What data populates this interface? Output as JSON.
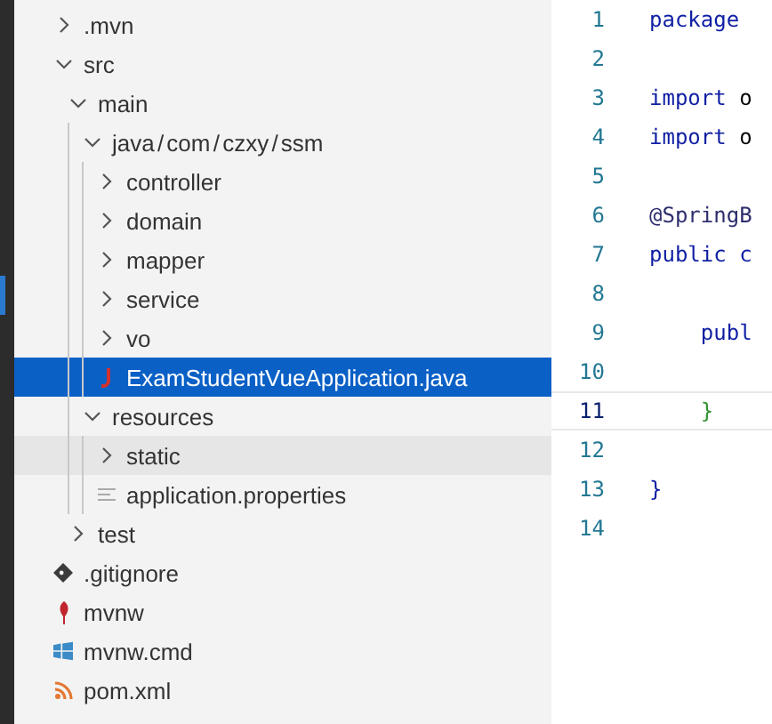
{
  "explorer": {
    "items": [
      {
        "label": ".mvn",
        "kind": "folder",
        "expanded": false,
        "selected": false,
        "hovered": false
      },
      {
        "label": "src",
        "kind": "folder",
        "expanded": true,
        "selected": false,
        "hovered": false,
        "children": [
          {
            "label": "main",
            "kind": "folder",
            "expanded": true,
            "selected": false,
            "hovered": false,
            "children": [
              {
                "label": "java / com / czxy / ssm",
                "kind": "folder",
                "expanded": true,
                "selected": false,
                "hovered": false,
                "children": [
                  {
                    "label": "controller",
                    "kind": "folder",
                    "expanded": false,
                    "selected": false,
                    "hovered": false
                  },
                  {
                    "label": "domain",
                    "kind": "folder",
                    "expanded": false,
                    "selected": false,
                    "hovered": false
                  },
                  {
                    "label": "mapper",
                    "kind": "folder",
                    "expanded": false,
                    "selected": false,
                    "hovered": false
                  },
                  {
                    "label": "service",
                    "kind": "folder",
                    "expanded": false,
                    "selected": false,
                    "hovered": false
                  },
                  {
                    "label": "vo",
                    "kind": "folder",
                    "expanded": false,
                    "selected": false,
                    "hovered": false
                  },
                  {
                    "label": "ExamStudentVueApplication.java",
                    "kind": "java",
                    "selected": true,
                    "hovered": false
                  }
                ]
              },
              {
                "label": "resources",
                "kind": "folder",
                "expanded": true,
                "selected": false,
                "hovered": false,
                "children": [
                  {
                    "label": "static",
                    "kind": "folder",
                    "expanded": false,
                    "selected": false,
                    "hovered": true
                  },
                  {
                    "label": "application.properties",
                    "kind": "text",
                    "selected": false,
                    "hovered": false
                  }
                ]
              }
            ]
          },
          {
            "label": "test",
            "kind": "folder",
            "expanded": false,
            "selected": false,
            "hovered": false
          }
        ]
      },
      {
        "label": ".gitignore",
        "kind": "git",
        "selected": false,
        "hovered": false
      },
      {
        "label": "mvnw",
        "kind": "maven",
        "selected": false,
        "hovered": false
      },
      {
        "label": "mvnw.cmd",
        "kind": "windows",
        "selected": false,
        "hovered": false
      },
      {
        "label": "pom.xml",
        "kind": "feed",
        "selected": false,
        "hovered": false
      }
    ]
  },
  "editor": {
    "lines": [
      {
        "number": "1",
        "current": false,
        "tokens": [
          {
            "text": "package",
            "kind": "keyword"
          }
        ]
      },
      {
        "number": "2",
        "current": false
      },
      {
        "number": "3",
        "current": false,
        "tokens": [
          {
            "text": "import",
            "kind": "keyword"
          },
          {
            "text": " o",
            "kind": "plain"
          }
        ]
      },
      {
        "number": "4",
        "current": false,
        "tokens": [
          {
            "text": "import",
            "kind": "keyword"
          },
          {
            "text": " o",
            "kind": "plain"
          }
        ]
      },
      {
        "number": "5",
        "current": false
      },
      {
        "number": "6",
        "current": false,
        "tokens": [
          {
            "text": "@SpringB",
            "kind": "annotation"
          }
        ]
      },
      {
        "number": "7",
        "current": false,
        "tokens": [
          {
            "text": "public",
            "kind": "keyword"
          },
          {
            "text": " c",
            "kind": "keyword"
          }
        ]
      },
      {
        "number": "8",
        "current": false
      },
      {
        "number": "9",
        "current": false,
        "tokens": [
          {
            "text": "    publ",
            "kind": "keyword"
          }
        ]
      },
      {
        "number": "10",
        "current": false
      },
      {
        "number": "11",
        "current": true,
        "tokens": [
          {
            "text": "    }",
            "kind": "brace"
          }
        ]
      },
      {
        "number": "12",
        "current": false
      },
      {
        "number": "13",
        "current": false,
        "tokens": [
          {
            "text": "}",
            "kind": "keyword"
          }
        ]
      },
      {
        "number": "14",
        "current": false
      }
    ]
  }
}
